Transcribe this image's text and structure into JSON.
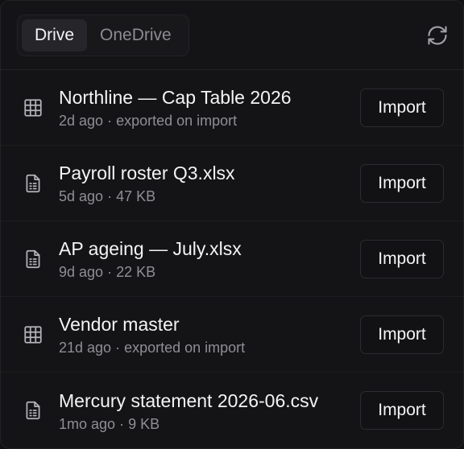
{
  "tabs": [
    {
      "label": "Drive",
      "active": true
    },
    {
      "label": "OneDrive",
      "active": false
    }
  ],
  "refresh_icon": "refresh-icon",
  "files": [
    {
      "icon": "spreadsheet-icon",
      "name": "Northline — Cap Table 2026",
      "age": "2d ago",
      "detail": "exported on import",
      "action": "Import"
    },
    {
      "icon": "file-icon",
      "name": "Payroll roster Q3.xlsx",
      "age": "5d ago",
      "detail": "47 KB",
      "action": "Import"
    },
    {
      "icon": "file-icon",
      "name": "AP ageing — July.xlsx",
      "age": "9d ago",
      "detail": "22 KB",
      "action": "Import"
    },
    {
      "icon": "spreadsheet-icon",
      "name": "Vendor master",
      "age": "21d ago",
      "detail": "exported on import",
      "action": "Import"
    },
    {
      "icon": "file-icon",
      "name": "Mercury statement 2026-06.csv",
      "age": "1mo ago",
      "detail": "9 KB",
      "action": "Import"
    }
  ],
  "colors": {
    "background": "#141416",
    "text": "#f4f4f5",
    "muted": "#8e8e95",
    "border": "#2c2c31"
  }
}
